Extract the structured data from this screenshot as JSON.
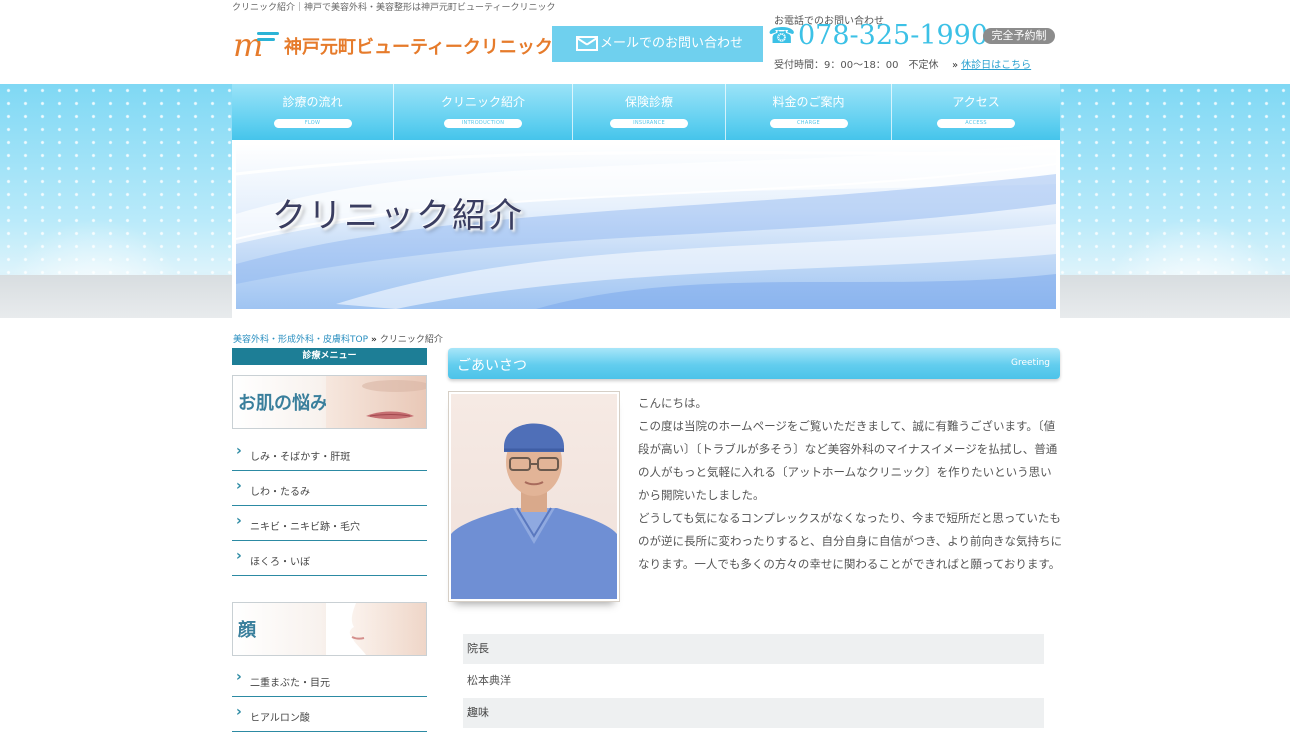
{
  "header": {
    "seo_text": "クリニック紹介｜神戸で美容外科・美容整形は神戸元町ビューティークリニック",
    "logo_mark": "m",
    "logo_text": "神戸元町ビューティークリニック",
    "mail_button": "メールでのお問い合わせ",
    "tel_label": "お電話でのお問い合わせ",
    "tel_icon": "☎",
    "tel_number": "078-325-1990",
    "reserve_badge": "完全予約制",
    "hours": "受付時間：9：00〜18：00　不定休",
    "holiday_arrow": "»",
    "holiday_link": "休診日はこちら"
  },
  "nav": [
    {
      "label": "診療の流れ",
      "sub": "FLOW"
    },
    {
      "label": "クリニック紹介",
      "sub": "INTRODUCTION"
    },
    {
      "label": "保険診療",
      "sub": "INSURANCE"
    },
    {
      "label": "料金のご案内",
      "sub": "CHARGE"
    },
    {
      "label": "アクセス",
      "sub": "ACCESS"
    }
  ],
  "hero": {
    "title": "クリニック紹介"
  },
  "breadcrumb": {
    "home": "美容外科・形成外科・皮膚科TOP",
    "sep": "»",
    "current": "クリニック紹介"
  },
  "sidebar": {
    "heading": "診療メニュー",
    "categories": [
      {
        "title": "お肌の悩み",
        "items": [
          "しみ・そばかす・肝斑",
          "しわ・たるみ",
          "ニキビ・ニキビ跡・毛穴",
          "ほくろ・いぼ"
        ]
      },
      {
        "title": "顔",
        "items": [
          "二重まぶた・目元",
          "ヒアルロン酸"
        ]
      }
    ]
  },
  "main": {
    "section_title": "ごあいさつ",
    "section_en": "Greeting",
    "greeting": [
      "こんにちは。",
      "この度は当院のホームページをご覧いただきまして、誠に有難うございます。〔値段が高い〕〔トラブルが多そう〕など美容外科のマイナスイメージを払拭し、普通の人がもっと気軽に入れる〔アットホームなクリニック〕を作りたいという思いから開院いたしました。",
      "どうしても気になるコンプレックスがなくなったり、今まで短所だと思っていたものが逆に長所に変わったりすると、自分自身に自信がつき、より前向きな気持ちになります。一人でも多くの方々の幸せに関わることができればと願っております。"
    ],
    "profile": {
      "director_label": "院長",
      "director_name": "松本典洋",
      "hobby_label": "趣味"
    }
  },
  "colors": {
    "accent": "#4cc3e9",
    "logo_orange": "#e67b2b",
    "sidebar_teal": "#1d7e96",
    "link_blue": "#2a8fc0"
  }
}
